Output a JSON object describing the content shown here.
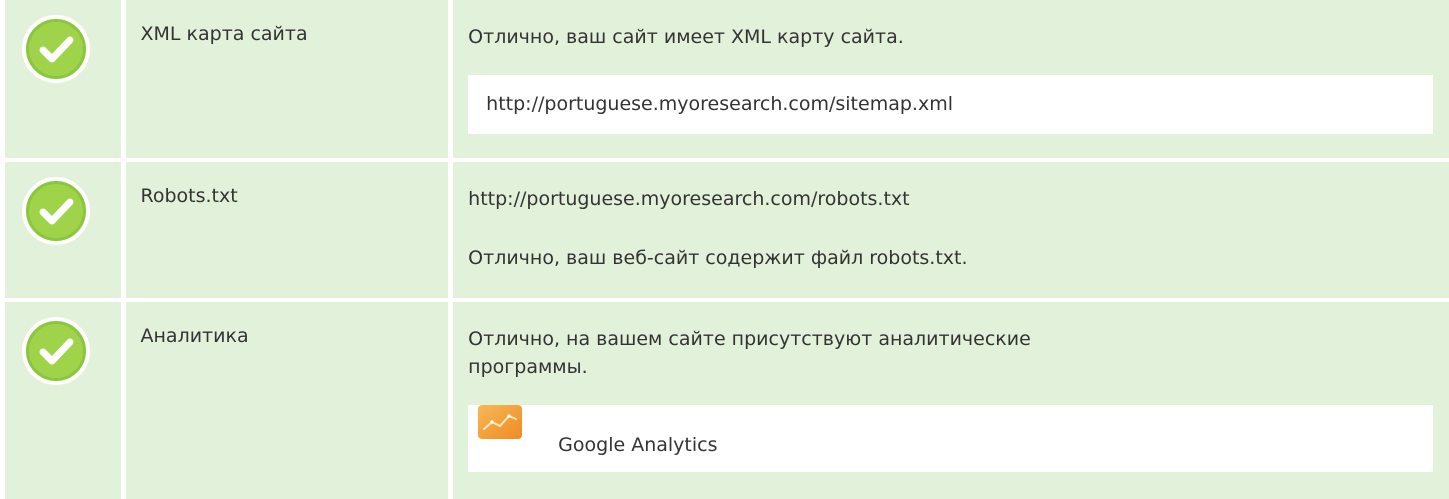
{
  "rows": [
    {
      "name": "XML карта сайта",
      "message": "Отлично, ваш сайт имеет XML карту сайта.",
      "url": "http://portuguese.myoresearch.com/sitemap.xml",
      "status": "passed"
    },
    {
      "name": "Robots.txt",
      "url": "http://portuguese.myoresearch.com/robots.txt",
      "message": "Отлично, ваш веб-сайт содержит файл robots.txt.",
      "status": "passed"
    },
    {
      "name": "Аналитика",
      "message_line1": "Отлично, на вашем сайте присутствуют аналитические",
      "message_line2": "программы.",
      "tool": "Google Analytics",
      "status": "passed"
    }
  ],
  "colors": {
    "row_background": "#e2f2da",
    "check_fill": "#8cc63f",
    "check_border": "#ffffff",
    "text": "#333333",
    "analytics_icon": "#f5a623"
  },
  "icons": {
    "status": "check-circle-icon",
    "tool": "google-analytics-icon"
  }
}
